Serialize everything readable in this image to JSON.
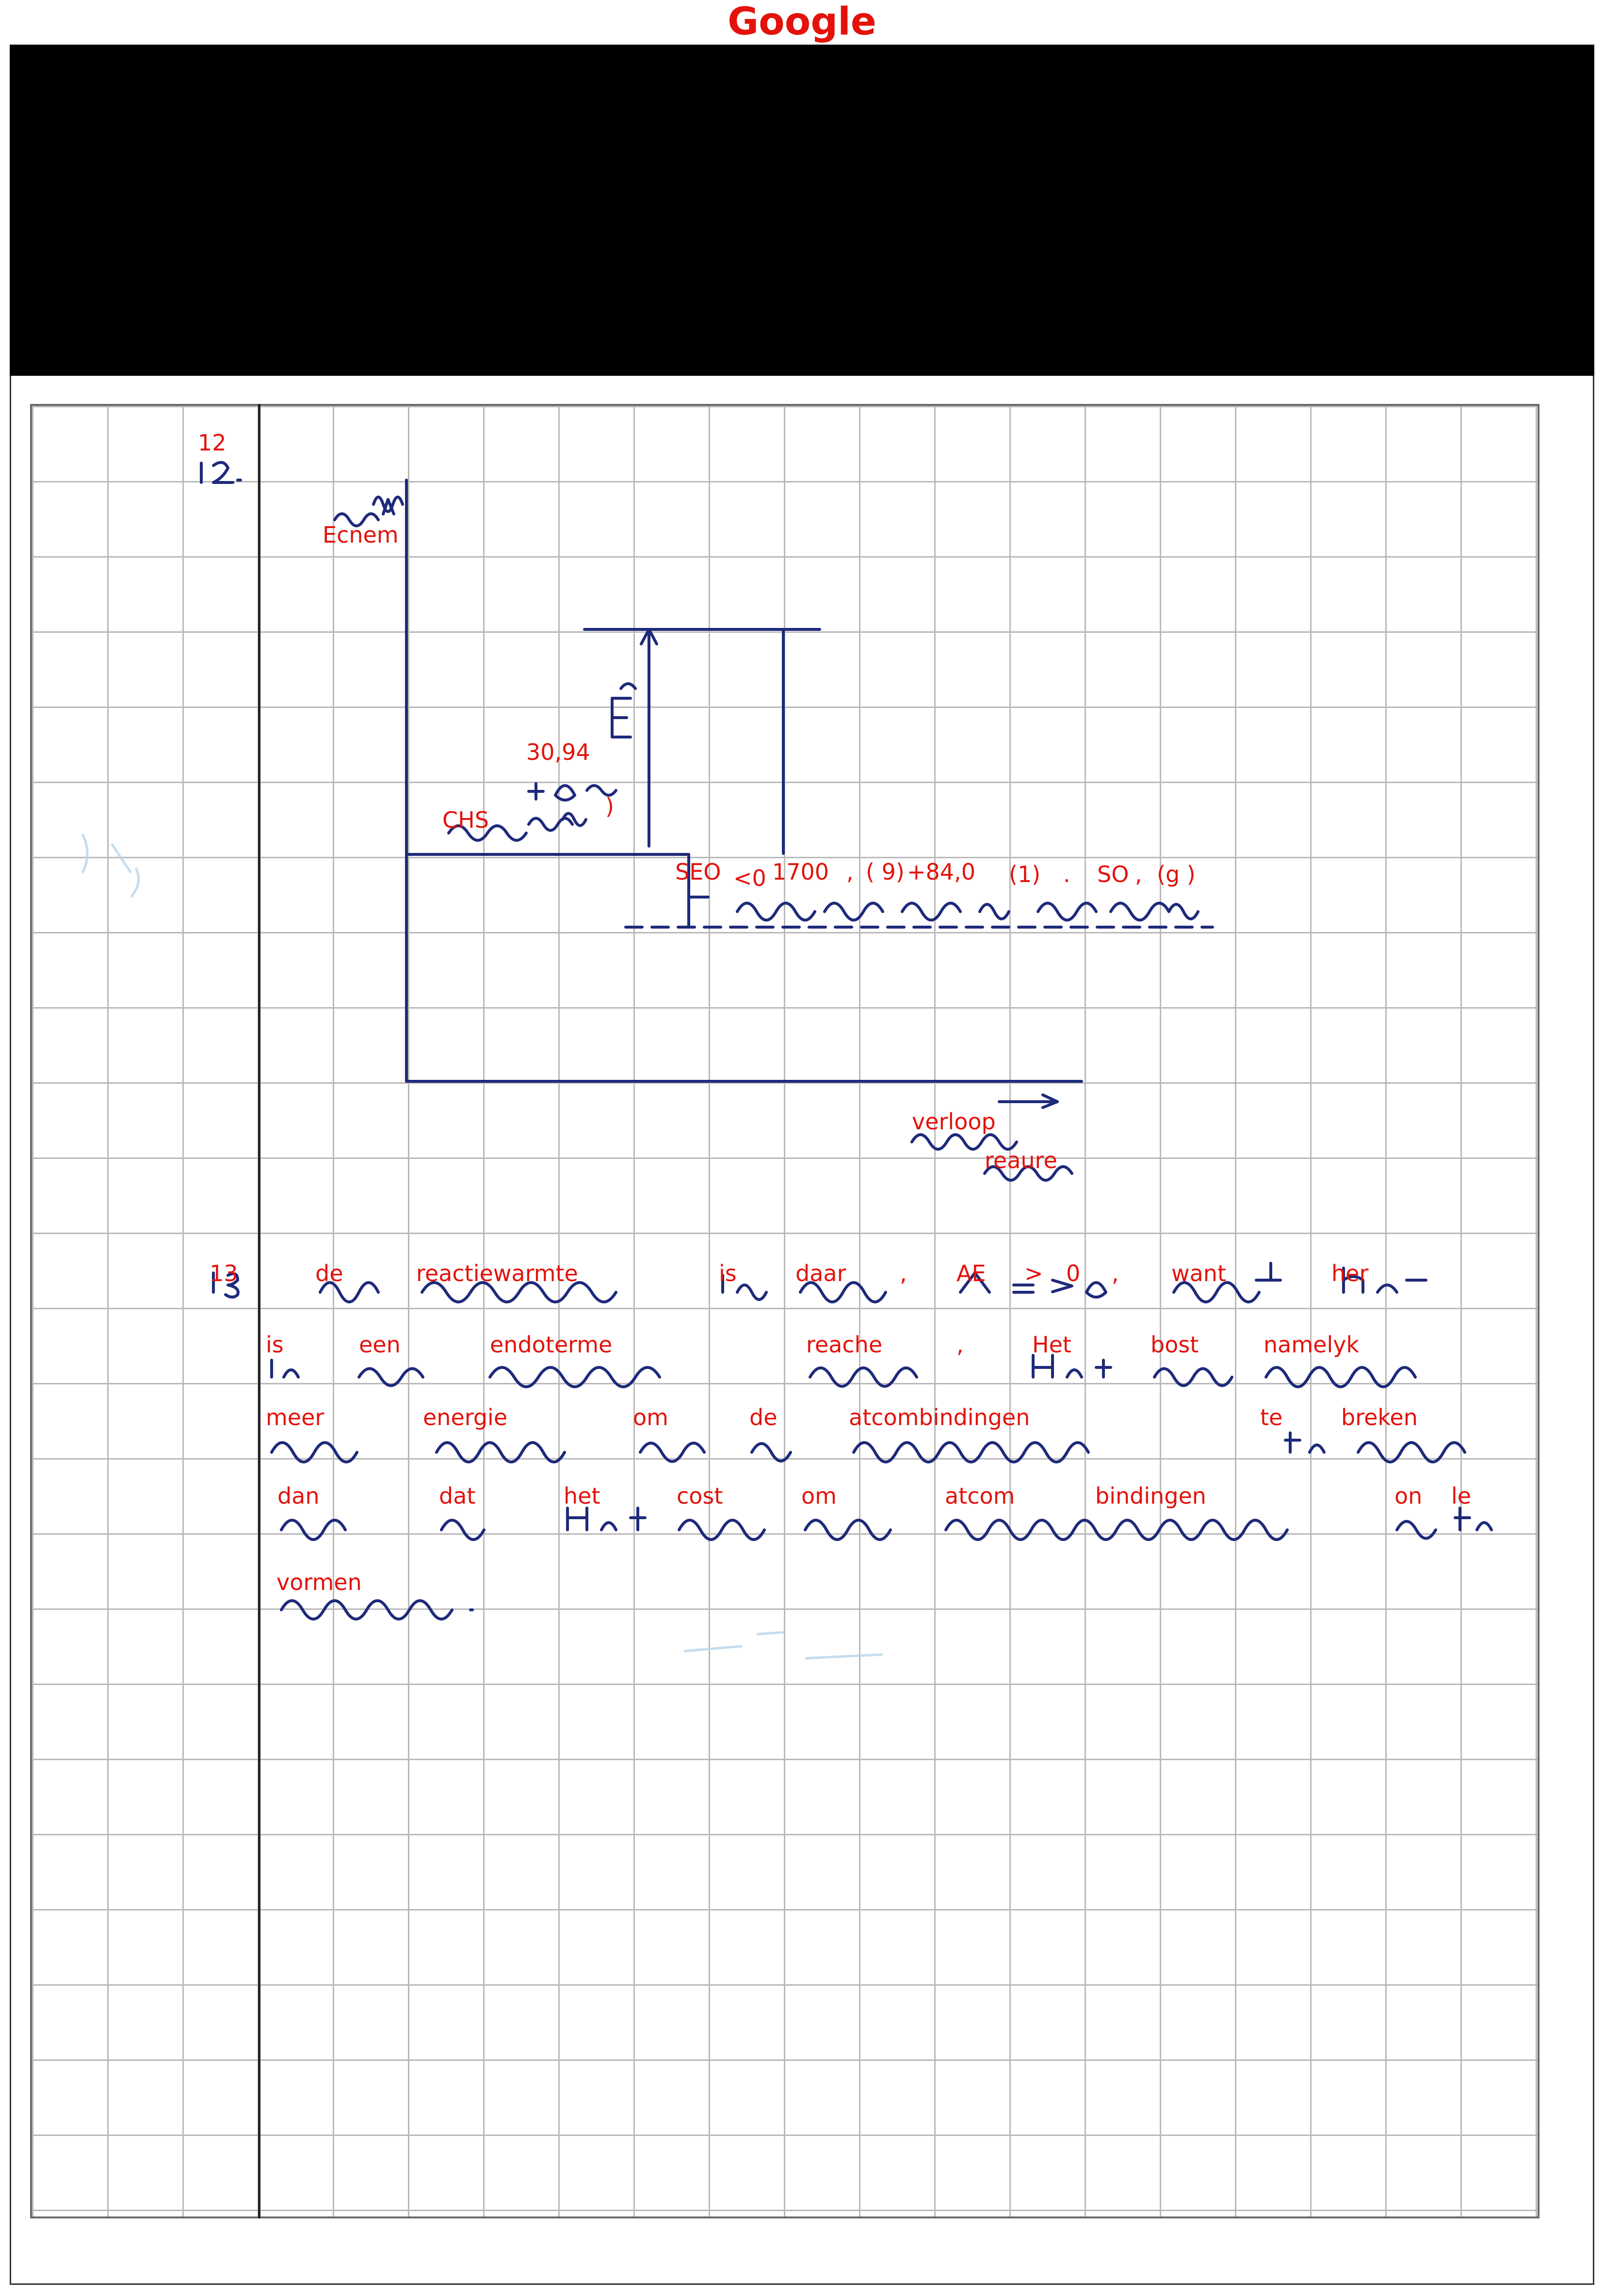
{
  "header": {
    "title": "Google"
  },
  "ocr_words": {
    "q12": "12",
    "ecnem": "Ecnem",
    "val_3094": "30,94",
    "paren1": ")",
    "chs": "CHS",
    "seo": "SEO",
    "lt0": "<0",
    "n1700": "1700",
    "comma1": ",",
    "paren9": "( 9)",
    "plus840": "+84,0",
    "paren1b": "(1)",
    "dot1": ".",
    "so": "SO",
    "comma2": ",",
    "g": "(g )",
    "verloop": "verloop",
    "reaure": "reaure",
    "q13": "13",
    "de1": "de",
    "reactiewarmte": "reactiewarmte",
    "is1": "is",
    "daar": "daar",
    "comma3": ",",
    "ae": "AE",
    "gt": ">",
    "zero": "0",
    "comma4": ",",
    "want": "want",
    "her": "her",
    "is2": "is",
    "een": "een",
    "endoterme": "endoterme",
    "reache": "reache",
    "comma5": ",",
    "het1": "Het",
    "bost": "bost",
    "namelyk": "namelyk",
    "meer": "meer",
    "energie": "energie",
    "om1": "om",
    "de2": "de",
    "atcombindingen": "atcombindingen",
    "te": "te",
    "breken": "breken",
    "dan": "dan",
    "dat": "dat",
    "het2": "het",
    "cost": "cost",
    "om2": "om",
    "atcom": "atcom",
    "bindingen": "bindingen",
    "on": "on",
    "le": "le",
    "vormen": "vormen"
  }
}
